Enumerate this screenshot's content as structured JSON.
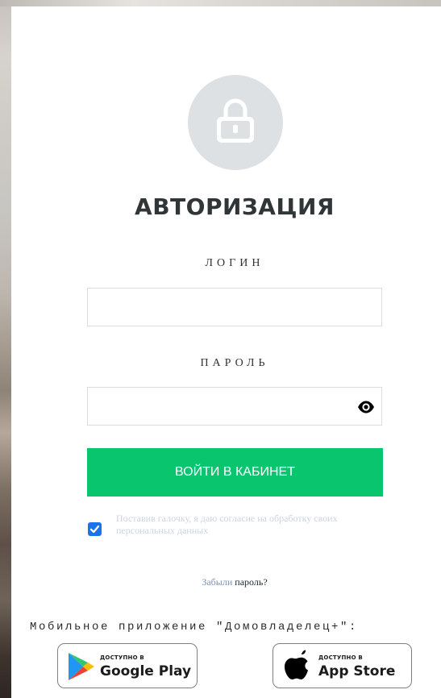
{
  "login_form": {
    "title": "АВТОРИЗАЦИЯ",
    "login_label": "ЛОГИН",
    "login_value": "",
    "password_label": "ПАРОЛЬ",
    "password_value": "",
    "submit_label": "ВОЙТИ В КАБИНЕТ",
    "consent_checked": true,
    "consent_text": "Поставив галочку, я даю согласие на обработку своих персональных данных",
    "forgot_link": "Забыли",
    "forgot_rest": " пароль?"
  },
  "mobile_apps": {
    "title": "Мобильное приложение \"Домовладелец+\":",
    "google_play": {
      "small_text": "ДОСТУПНО В",
      "big_text": "Google Play",
      "icon": "google-play-icon"
    },
    "app_store": {
      "small_text": "ДОСТУПНО В",
      "big_text": "App Store",
      "icon": "apple-icon"
    }
  },
  "icons": {
    "lock": "lock-icon",
    "password_toggle": "eye-icon",
    "checkbox": "checkmark-icon"
  },
  "colors": {
    "accent_green": "#08c56e",
    "checkbox_blue": "#1a73e8",
    "lock_circle": "#dde1e4",
    "link": "#7f91b3"
  }
}
